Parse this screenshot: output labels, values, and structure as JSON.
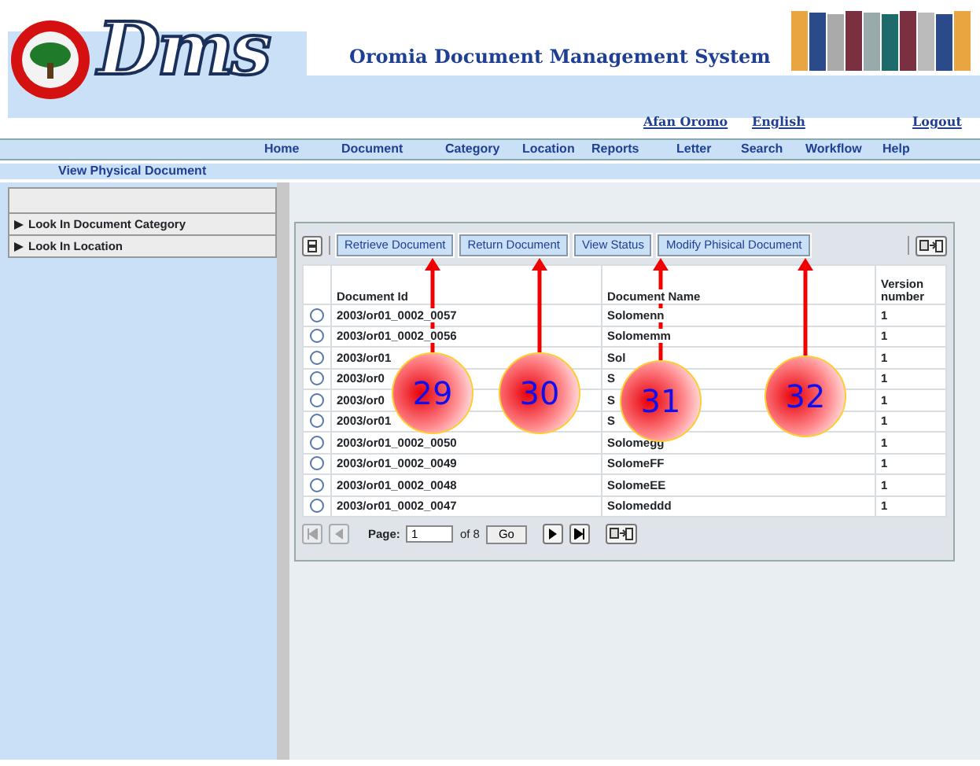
{
  "header": {
    "logo_text": "Dms",
    "title": "Oromia Document Management System",
    "languages": [
      "Afan Oromo",
      "English"
    ],
    "logout": "Logout"
  },
  "nav": [
    "Home",
    "Document",
    "Category",
    "Location",
    "Reports",
    "Letter",
    "Search",
    "Workflow",
    "Help"
  ],
  "breadcrumb": "View Physical Document",
  "sidebar": {
    "items": [
      {
        "label": "Look In Document Category",
        "expanded": false
      },
      {
        "label": "Look In Location",
        "expanded": false
      }
    ]
  },
  "toolbar": {
    "buttons": [
      "Retrieve Document",
      "Return Document",
      "View Status",
      "Modify Phisical Document"
    ]
  },
  "table": {
    "columns": [
      "Document Id",
      "Document Name",
      "Version number"
    ],
    "rows": [
      {
        "id": "2003/or01_0002_0057",
        "name": "Solomenn",
        "version": "1",
        "selected": false
      },
      {
        "id": "2003/or01_0002_0056",
        "name": "Solomemm",
        "version": "1",
        "selected": false
      },
      {
        "id": "2003/or01",
        "name": "Sol",
        "version": "1",
        "selected": false
      },
      {
        "id": "2003/or0",
        "name": "S",
        "version": "1",
        "selected": false
      },
      {
        "id": "2003/or0",
        "name": "S",
        "version": "1",
        "selected": false
      },
      {
        "id": "2003/or01",
        "name": "S",
        "version": "1",
        "selected": false
      },
      {
        "id": "2003/or01_0002_0050",
        "name": "Solomegg",
        "version": "1",
        "selected": false
      },
      {
        "id": "2003/or01_0002_0049",
        "name": "SolomeFF",
        "version": "1",
        "selected": false
      },
      {
        "id": "2003/or01_0002_0048",
        "name": "SolomeEE",
        "version": "1",
        "selected": false
      },
      {
        "id": "2003/or01_0002_0047",
        "name": "Solomeddd",
        "version": "1",
        "selected": false
      }
    ]
  },
  "pager": {
    "label": "Page:",
    "value": "1",
    "of": "of 8",
    "go": "Go"
  },
  "callouts": [
    {
      "number": "29"
    },
    {
      "number": "30"
    },
    {
      "number": "31"
    },
    {
      "number": "32"
    }
  ]
}
